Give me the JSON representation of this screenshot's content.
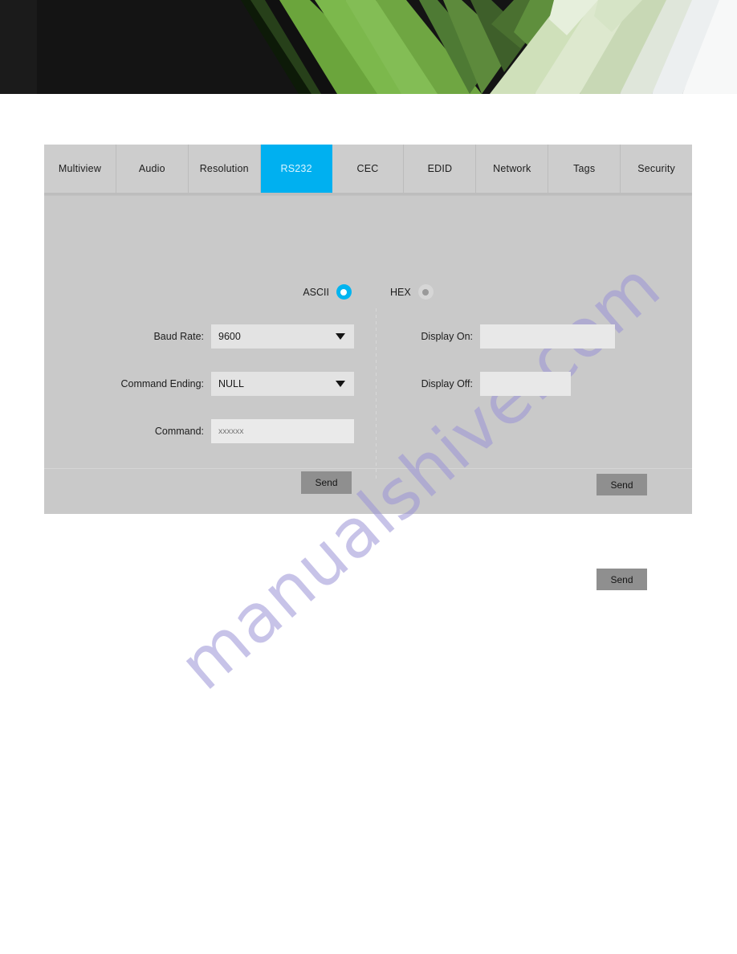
{
  "banner": {
    "name": "decorative-header-graphic",
    "colors": {
      "dark": "#141414",
      "green_dark": "#4f7a34",
      "green_mid": "#76b043",
      "green_light": "#c3d9a8",
      "green_pale": "#e2ebd8",
      "white": "#ffffff"
    }
  },
  "tabs": [
    {
      "label": "Multiview",
      "active": false
    },
    {
      "label": "Audio",
      "active": false
    },
    {
      "label": "Resolution",
      "active": false
    },
    {
      "label": "RS232",
      "active": true
    },
    {
      "label": "CEC",
      "active": false
    },
    {
      "label": "EDID",
      "active": false
    },
    {
      "label": "Network",
      "active": false
    },
    {
      "label": "Tags",
      "active": false
    },
    {
      "label": "Security",
      "active": false
    }
  ],
  "mode": {
    "options": [
      {
        "label": "ASCII",
        "selected": true
      },
      {
        "label": "HEX",
        "selected": false
      }
    ]
  },
  "left_form": {
    "baud_rate": {
      "label": "Baud Rate:",
      "value": "9600"
    },
    "command_ending": {
      "label": "Command Ending:",
      "value": "NULL"
    },
    "command": {
      "label": "Command:",
      "value": "",
      "placeholder": "xxxxxx"
    },
    "send_label": "Send"
  },
  "right_form": {
    "display_on": {
      "label": "Display On:",
      "value": "",
      "placeholder": "",
      "send_label": "Send"
    },
    "display_off": {
      "label": "Display Off:",
      "value": "",
      "placeholder": "",
      "send_label": "Send"
    }
  },
  "watermark": {
    "text": "manualshive.com"
  },
  "theme": {
    "accent": "#00b0f0",
    "panel_bg": "#c9c9c9",
    "tab_bg": "#cdcdcd",
    "field_bg": "#e3e3e3",
    "button_bg": "#8f8f8f"
  }
}
